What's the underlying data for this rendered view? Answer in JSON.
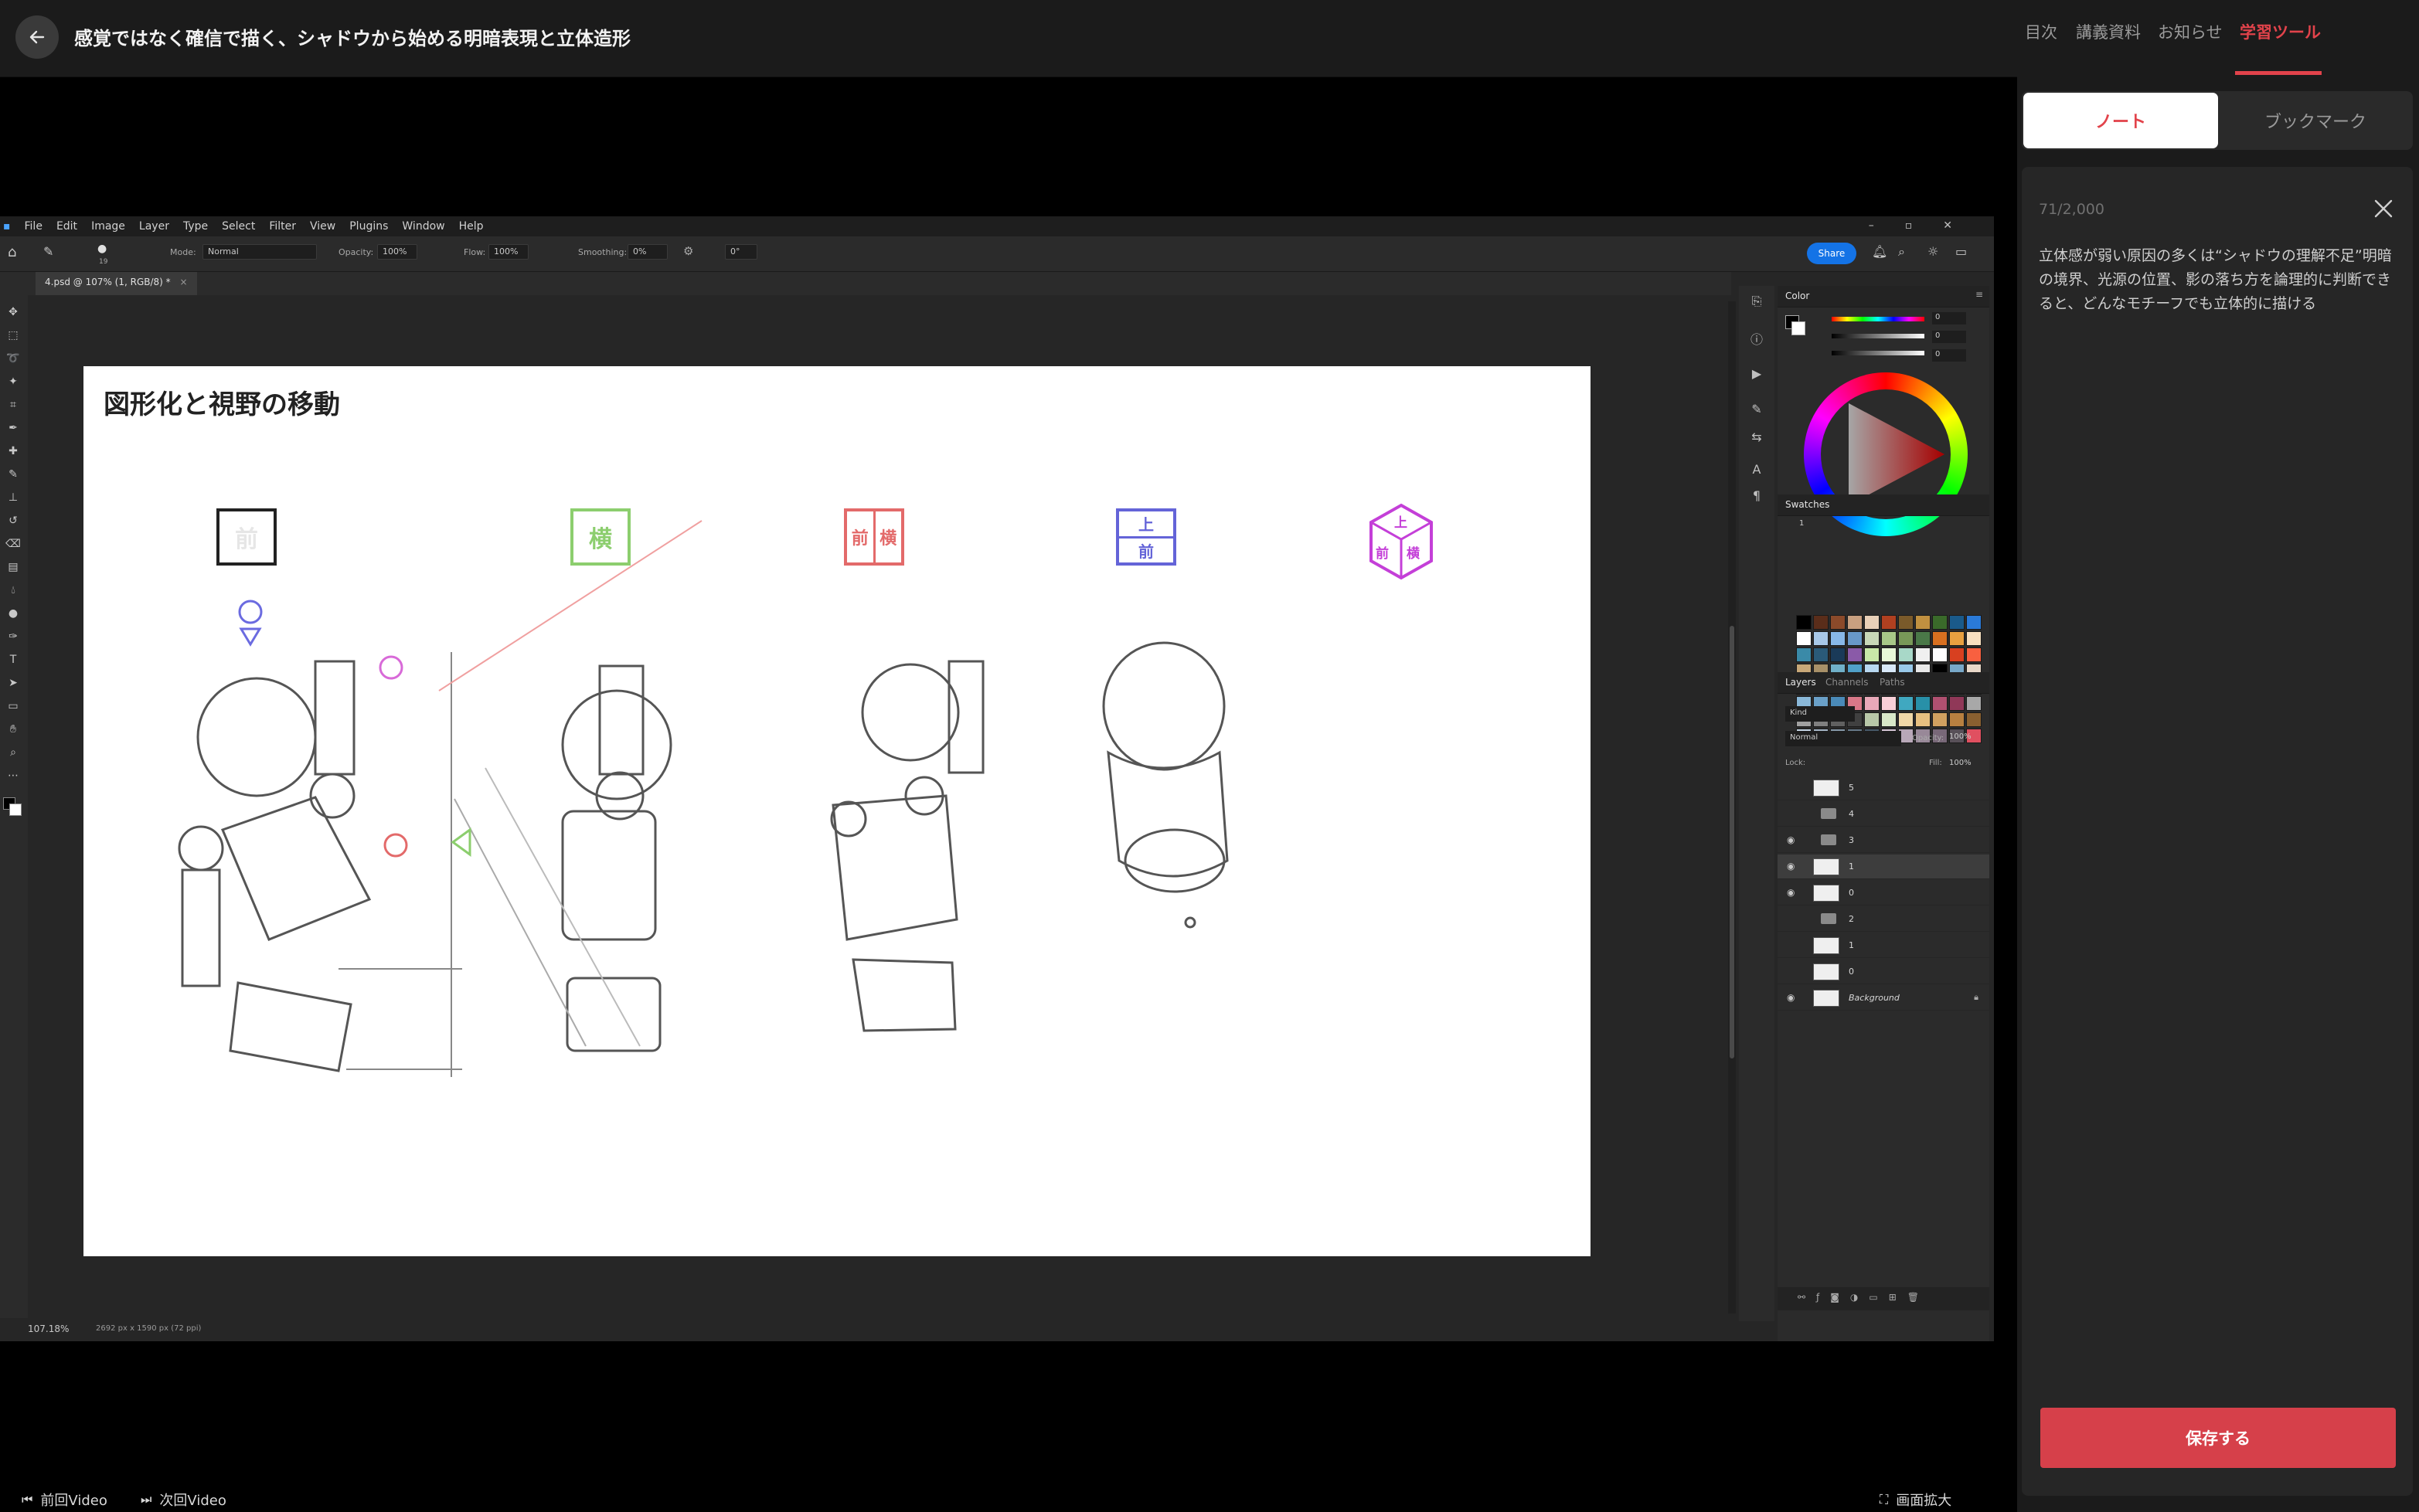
{
  "header": {
    "title": "感覚ではなく確信で描く、シャドウから始める明暗表現と立体造形"
  },
  "right_tabs": [
    {
      "label": "目次",
      "active": false
    },
    {
      "label": "講義資料",
      "active": false
    },
    {
      "label": "お知らせ",
      "active": false
    },
    {
      "label": "学習ツール",
      "active": true
    }
  ],
  "segment": {
    "note": "ノート",
    "bookmark": "ブックマーク"
  },
  "note": {
    "count": "71/2,000",
    "text": "立体感が弱い原因の多くは“シャドウの理解不足”明暗の境界、光源の位置、影の落ち方を論理的に判断できると、どんなモチーフでも立体的に描ける",
    "save_label": "保存する"
  },
  "bottom": {
    "prev": "前回Video",
    "next": "次回Video",
    "fullscreen": "画面拡大"
  },
  "ps": {
    "menu": [
      "File",
      "Edit",
      "Image",
      "Layer",
      "Type",
      "Select",
      "Filter",
      "View",
      "Plugins",
      "Window",
      "Help"
    ],
    "options": {
      "brush_size": "19",
      "mode_label": "Mode:",
      "mode_value": "Normal",
      "opacity_label": "Opacity:",
      "opacity_value": "100%",
      "flow_label": "Flow:",
      "flow_value": "100%",
      "smoothing_label": "Smoothing:",
      "smoothing_value": "0%",
      "angle_value": "0°",
      "share": "Share"
    },
    "doc_tab": "4.psd @ 107% (1, RGB/8) *",
    "zoom": "107.18%",
    "doc_size": "2692 px x 1590 px (72 ppi)",
    "panels": {
      "color": "Color",
      "swatches": "Swatches",
      "swatch_group": "1",
      "layers": "Layers",
      "channels": "Channels",
      "paths": "Paths",
      "kind": "Kind",
      "blend": "Normal",
      "opacity_label": "Opacity:",
      "opacity_value": "100%",
      "lock_label": "Lock:",
      "fill_label": "Fill:",
      "fill_value": "100%",
      "color_values": [
        "0",
        "0",
        "0"
      ]
    },
    "layers": [
      {
        "name": "5",
        "visible": false,
        "type": "layer",
        "selected": false
      },
      {
        "name": "4",
        "visible": false,
        "type": "folder",
        "selected": false
      },
      {
        "name": "3",
        "visible": true,
        "type": "folder-open",
        "selected": false
      },
      {
        "name": "1",
        "visible": true,
        "type": "layer",
        "selected": true
      },
      {
        "name": "0",
        "visible": true,
        "type": "layer",
        "selected": false
      },
      {
        "name": "2",
        "visible": false,
        "type": "folder",
        "selected": false
      },
      {
        "name": "1",
        "visible": false,
        "type": "layer",
        "selected": false
      },
      {
        "name": "0",
        "visible": false,
        "type": "layer",
        "selected": false
      },
      {
        "name": "Background",
        "visible": true,
        "type": "background",
        "selected": false
      }
    ],
    "swatch_colors": [
      "#000000",
      "#5a2d1a",
      "#8b4a2a",
      "#c8a080",
      "#e8d0b8",
      "#b04020",
      "#7a5a2a",
      "#c09040",
      "#3a6a2a",
      "#1a5a8a",
      "#2a7ad8",
      "#ffffff",
      "#a8c8e8",
      "#88b8e8",
      "#6898c8",
      "#c8d8b8",
      "#a8c888",
      "#789858",
      "#4a7848",
      "#d87020",
      "#e8a040",
      "#f8e0c0",
      "#3a8aa8",
      "#2a5a78",
      "#1a3a58",
      "#8a5aa8",
      "#c8e8a8",
      "#e8f8d8",
      "#a8d8c8",
      "#f0f0f0",
      "#ffffff",
      "#d84020",
      "#f86040",
      "#c8a878",
      "#a89068",
      "#70b0c8",
      "#50a0c8",
      "#b8d8f0",
      "#d8e8f8",
      "#98c8e8",
      "#e8e8e8",
      "#000000",
      "#78a8c8",
      "#e8d8c8",
      "#2a4a6a",
      "#1a2a4a",
      "#4a8a6a",
      "#3a7a5a",
      "#a8e0e0",
      "#c8f0f0",
      "#80d0d0",
      "#50b0b0",
      "#308090",
      "#c86080",
      "#e890a8",
      "#8ab8d8",
      "#6aa0c8",
      "#4a8ab8",
      "#d87888",
      "#e8a8b8",
      "#f8d0d8",
      "#40a8c0",
      "#2890a8",
      "#b05070",
      "#903858",
      "#a8a8a8",
      "#a0a0a0",
      "#808080",
      "#606060",
      "#404040",
      "#b8c8a8",
      "#d8e8c8",
      "#f0d8a8",
      "#e8c080",
      "#d0a060",
      "#b88040",
      "#8a6030",
      "#c8d8e8",
      "#a8b8c8",
      "#889aaa",
      "#687a8a",
      "#485a6a",
      "#d8c8d8",
      "#b8a8b8",
      "#988898",
      "#786878",
      "#585058",
      "#e05060"
    ]
  },
  "drawing": {
    "title": "図形化と視野の移動",
    "labels": {
      "front": "前",
      "side": "横",
      "top": "上"
    }
  }
}
